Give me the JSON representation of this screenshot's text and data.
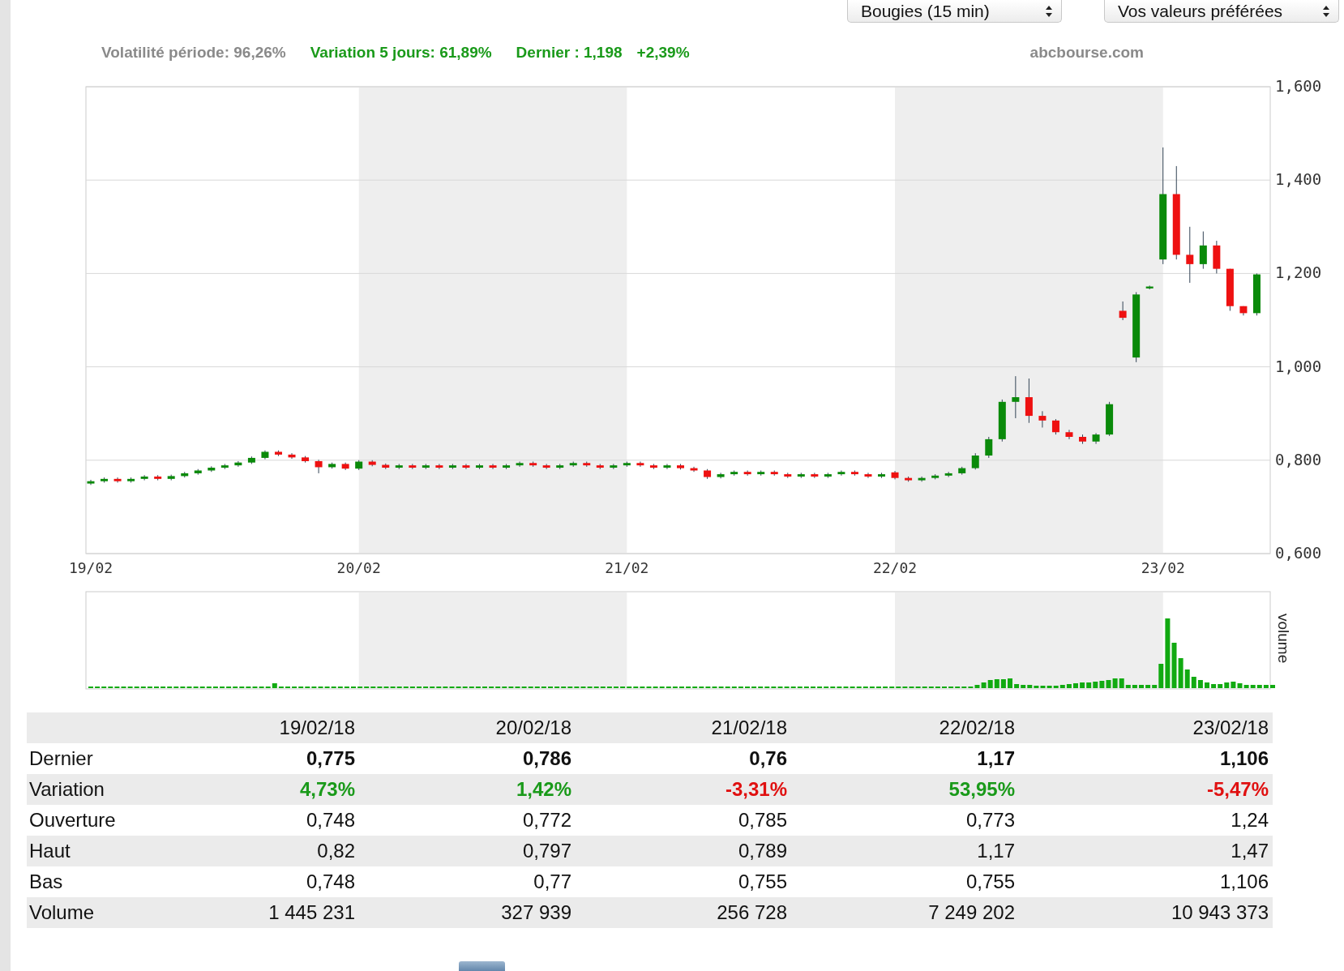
{
  "selects": [
    {
      "value": "Bougies (15 min)"
    },
    {
      "value": "Vos valeurs préférées"
    }
  ],
  "info": {
    "volatility": "Volatilité période: 96,26%",
    "variation": "Variation 5 jours: 61,89%",
    "last": "Dernier : 1,198",
    "change": "+2,39%",
    "source": "abcbourse.com"
  },
  "chart": {
    "chart_data": {
      "type": "candlestick",
      "ylim": [
        0.6,
        1.6
      ],
      "yticks": [
        {
          "value": 1.6,
          "label": "1,600"
        },
        {
          "value": 1.4,
          "label": "1,400"
        },
        {
          "value": 1.2,
          "label": "1,200"
        },
        {
          "value": 1.0,
          "label": "1,000"
        },
        {
          "value": 0.8,
          "label": "0,800"
        },
        {
          "value": 0.6,
          "label": "0,600"
        }
      ],
      "categories": [
        "19/02",
        null,
        null,
        null,
        null,
        null,
        null,
        null,
        null,
        null,
        null,
        null,
        null,
        null,
        null,
        null,
        null,
        null,
        null,
        null,
        "20/02",
        null,
        null,
        null,
        null,
        null,
        null,
        null,
        null,
        null,
        null,
        null,
        null,
        null,
        null,
        null,
        null,
        null,
        null,
        null,
        "21/02",
        null,
        null,
        null,
        null,
        null,
        null,
        null,
        null,
        null,
        null,
        null,
        null,
        null,
        null,
        null,
        null,
        null,
        null,
        null,
        "22/02",
        null,
        null,
        null,
        null,
        null,
        null,
        null,
        null,
        null,
        null,
        null,
        null,
        null,
        null,
        null,
        null,
        null,
        null,
        null,
        "23/02",
        null,
        null,
        null,
        null,
        null,
        null,
        null
      ],
      "grid": true,
      "ohlc": [
        [
          0.75,
          0.758,
          0.747,
          0.755
        ],
        [
          0.755,
          0.763,
          0.752,
          0.76
        ],
        [
          0.76,
          0.763,
          0.752,
          0.755
        ],
        [
          0.755,
          0.763,
          0.752,
          0.76
        ],
        [
          0.76,
          0.768,
          0.757,
          0.765
        ],
        [
          0.765,
          0.768,
          0.757,
          0.76
        ],
        [
          0.76,
          0.769,
          0.757,
          0.766
        ],
        [
          0.766,
          0.775,
          0.763,
          0.772
        ],
        [
          0.772,
          0.781,
          0.769,
          0.778
        ],
        [
          0.778,
          0.787,
          0.775,
          0.784
        ],
        [
          0.784,
          0.792,
          0.781,
          0.789
        ],
        [
          0.789,
          0.798,
          0.786,
          0.795
        ],
        [
          0.795,
          0.808,
          0.792,
          0.805
        ],
        [
          0.805,
          0.821,
          0.802,
          0.818
        ],
        [
          0.818,
          0.821,
          0.809,
          0.812
        ],
        [
          0.812,
          0.815,
          0.803,
          0.806
        ],
        [
          0.806,
          0.809,
          0.795,
          0.798
        ],
        [
          0.798,
          0.801,
          0.772,
          0.785
        ],
        [
          0.785,
          0.795,
          0.782,
          0.792
        ],
        [
          0.792,
          0.795,
          0.779,
          0.782
        ],
        [
          0.782,
          0.8,
          0.779,
          0.797
        ],
        [
          0.797,
          0.8,
          0.787,
          0.79
        ],
        [
          0.79,
          0.793,
          0.781,
          0.784
        ],
        [
          0.784,
          0.792,
          0.781,
          0.789
        ],
        [
          0.789,
          0.792,
          0.781,
          0.784
        ],
        [
          0.784,
          0.792,
          0.781,
          0.789
        ],
        [
          0.789,
          0.792,
          0.781,
          0.784
        ],
        [
          0.784,
          0.792,
          0.781,
          0.789
        ],
        [
          0.789,
          0.792,
          0.781,
          0.784
        ],
        [
          0.784,
          0.792,
          0.781,
          0.789
        ],
        [
          0.789,
          0.792,
          0.781,
          0.784
        ],
        [
          0.784,
          0.792,
          0.781,
          0.789
        ],
        [
          0.789,
          0.797,
          0.786,
          0.794
        ],
        [
          0.794,
          0.797,
          0.786,
          0.789
        ],
        [
          0.789,
          0.792,
          0.781,
          0.784
        ],
        [
          0.784,
          0.792,
          0.781,
          0.789
        ],
        [
          0.789,
          0.797,
          0.786,
          0.794
        ],
        [
          0.794,
          0.797,
          0.786,
          0.789
        ],
        [
          0.789,
          0.792,
          0.781,
          0.784
        ],
        [
          0.784,
          0.792,
          0.781,
          0.789
        ],
        [
          0.789,
          0.797,
          0.786,
          0.794
        ],
        [
          0.794,
          0.797,
          0.786,
          0.789
        ],
        [
          0.789,
          0.792,
          0.781,
          0.784
        ],
        [
          0.784,
          0.792,
          0.781,
          0.789
        ],
        [
          0.789,
          0.792,
          0.78,
          0.783
        ],
        [
          0.783,
          0.786,
          0.775,
          0.778
        ],
        [
          0.778,
          0.781,
          0.76,
          0.764
        ],
        [
          0.764,
          0.773,
          0.761,
          0.77
        ],
        [
          0.77,
          0.778,
          0.767,
          0.775
        ],
        [
          0.775,
          0.778,
          0.767,
          0.77
        ],
        [
          0.77,
          0.778,
          0.767,
          0.775
        ],
        [
          0.775,
          0.778,
          0.767,
          0.77
        ],
        [
          0.77,
          0.773,
          0.762,
          0.765
        ],
        [
          0.765,
          0.773,
          0.762,
          0.77
        ],
        [
          0.77,
          0.773,
          0.762,
          0.765
        ],
        [
          0.765,
          0.773,
          0.762,
          0.77
        ],
        [
          0.77,
          0.778,
          0.767,
          0.775
        ],
        [
          0.775,
          0.778,
          0.767,
          0.77
        ],
        [
          0.77,
          0.773,
          0.762,
          0.765
        ],
        [
          0.765,
          0.773,
          0.762,
          0.77
        ],
        [
          0.774,
          0.777,
          0.759,
          0.762
        ],
        [
          0.762,
          0.765,
          0.754,
          0.757
        ],
        [
          0.757,
          0.765,
          0.754,
          0.762
        ],
        [
          0.762,
          0.77,
          0.759,
          0.767
        ],
        [
          0.767,
          0.775,
          0.764,
          0.772
        ],
        [
          0.772,
          0.786,
          0.769,
          0.783
        ],
        [
          0.783,
          0.815,
          0.78,
          0.81
        ],
        [
          0.81,
          0.85,
          0.805,
          0.845
        ],
        [
          0.845,
          0.93,
          0.84,
          0.925
        ],
        [
          0.925,
          0.98,
          0.89,
          0.935
        ],
        [
          0.935,
          0.975,
          0.88,
          0.895
        ],
        [
          0.895,
          0.905,
          0.87,
          0.885
        ],
        [
          0.885,
          0.888,
          0.855,
          0.86
        ],
        [
          0.86,
          0.865,
          0.845,
          0.85
        ],
        [
          0.85,
          0.855,
          0.835,
          0.84
        ],
        [
          0.84,
          0.858,
          0.835,
          0.855
        ],
        [
          0.855,
          0.925,
          0.852,
          0.92
        ],
        [
          1.12,
          1.14,
          1.1,
          1.105
        ],
        [
          1.02,
          1.16,
          1.01,
          1.155
        ],
        [
          1.168,
          1.174,
          1.166,
          1.172
        ],
        [
          1.23,
          1.47,
          1.22,
          1.37
        ],
        [
          1.37,
          1.43,
          1.23,
          1.24
        ],
        [
          1.24,
          1.3,
          1.18,
          1.22
        ],
        [
          1.22,
          1.29,
          1.21,
          1.26
        ],
        [
          1.26,
          1.27,
          1.2,
          1.21
        ],
        [
          1.21,
          1.21,
          1.12,
          1.13
        ],
        [
          1.13,
          1.13,
          1.11,
          1.115
        ],
        [
          1.115,
          1.2,
          1.11,
          1.198
        ]
      ]
    },
    "volume_label": "volume"
  },
  "table": {
    "columns": [
      "19/02/18",
      "20/02/18",
      "21/02/18",
      "22/02/18",
      "23/02/18"
    ],
    "rows": [
      {
        "label": "Dernier",
        "kind": "bold",
        "cells": [
          {
            "text": "0,775"
          },
          {
            "text": "0,786"
          },
          {
            "text": "0,76"
          },
          {
            "text": "1,17"
          },
          {
            "text": "1,106"
          }
        ]
      },
      {
        "label": "Variation",
        "kind": "variation",
        "cells": [
          {
            "text": "4,73%",
            "color": "#1a9a1a"
          },
          {
            "text": "1,42%",
            "color": "#1a9a1a"
          },
          {
            "text": "-3,31%",
            "color": "#e01010"
          },
          {
            "text": "53,95%",
            "color": "#1a9a1a"
          },
          {
            "text": "-5,47%",
            "color": "#e01010"
          }
        ]
      },
      {
        "label": "Ouverture",
        "kind": "plain",
        "cells": [
          {
            "text": "0,748"
          },
          {
            "text": "0,772"
          },
          {
            "text": "0,785"
          },
          {
            "text": "0,773"
          },
          {
            "text": "1,24"
          }
        ]
      },
      {
        "label": "Haut",
        "kind": "plain",
        "cells": [
          {
            "text": "0,82"
          },
          {
            "text": "0,797"
          },
          {
            "text": "0,789"
          },
          {
            "text": "1,17"
          },
          {
            "text": "1,47"
          }
        ]
      },
      {
        "label": "Bas",
        "kind": "plain",
        "cells": [
          {
            "text": "0,748"
          },
          {
            "text": "0,77"
          },
          {
            "text": "0,755"
          },
          {
            "text": "0,755"
          },
          {
            "text": "1,106"
          }
        ]
      },
      {
        "label": "Volume",
        "kind": "plain",
        "cells": [
          {
            "text": "1 445 231"
          },
          {
            "text": "327 939"
          },
          {
            "text": "256 728"
          },
          {
            "text": "7 249 202"
          },
          {
            "text": "10 943 373"
          }
        ]
      }
    ]
  }
}
